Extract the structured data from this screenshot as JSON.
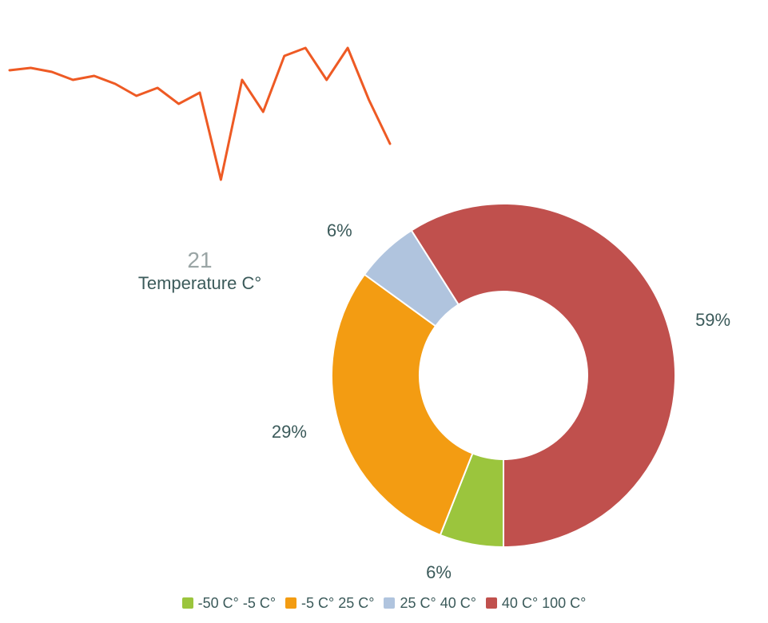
{
  "spark": {
    "value": "21",
    "label": "Temperature C°",
    "color": "#ee5a24",
    "points": [
      78,
      75,
      80,
      90,
      85,
      95,
      110,
      100,
      120,
      106,
      215,
      90,
      130,
      60,
      50,
      90,
      50,
      115,
      170
    ]
  },
  "donut": {
    "data": [
      {
        "name": "-50 C° -5 C°",
        "value": 6,
        "color": "#9bc53d",
        "pctLabel": "6%"
      },
      {
        "name": "-5 C° 25 C°",
        "value": 29,
        "color": "#f39c12",
        "pctLabel": "29%"
      },
      {
        "name": "25 C° 40 C°",
        "value": 6,
        "color": "#b0c4de",
        "pctLabel": "6%"
      },
      {
        "name": "40 C° 100 C°",
        "value": 59,
        "color": "#c0504d",
        "pctLabel": "59%"
      }
    ],
    "startAngle": 90,
    "direction": "cw"
  },
  "legend": {
    "items": [
      {
        "label": "-50 C° -5 C°",
        "color": "#9bc53d"
      },
      {
        "label": "-5 C° 25 C°",
        "color": "#f39c12"
      },
      {
        "label": "25 C° 40 C°",
        "color": "#b0c4de"
      },
      {
        "label": "40 C° 100 C°",
        "color": "#c0504d"
      }
    ]
  },
  "chart_data": [
    {
      "type": "line",
      "title": "Temperature C°",
      "current_value": 21,
      "series": [
        {
          "name": "Temperature",
          "values": [
            78,
            75,
            80,
            90,
            85,
            95,
            110,
            100,
            120,
            106,
            215,
            90,
            130,
            60,
            50,
            90,
            50,
            115,
            170
          ]
        }
      ],
      "note": "sparkline pixel y-values (relative); no axes shown"
    },
    {
      "type": "pie",
      "title": "",
      "categories": [
        "-50 C° -5 C°",
        "-5 C° 25 C°",
        "25 C° 40 C°",
        "40 C° 100 C°"
      ],
      "values": [
        6,
        29,
        6,
        59
      ],
      "labels": [
        "6%",
        "29%",
        "6%",
        "59%"
      ],
      "colors": [
        "#9bc53d",
        "#f39c12",
        "#b0c4de",
        "#c0504d"
      ],
      "donut": true
    }
  ]
}
